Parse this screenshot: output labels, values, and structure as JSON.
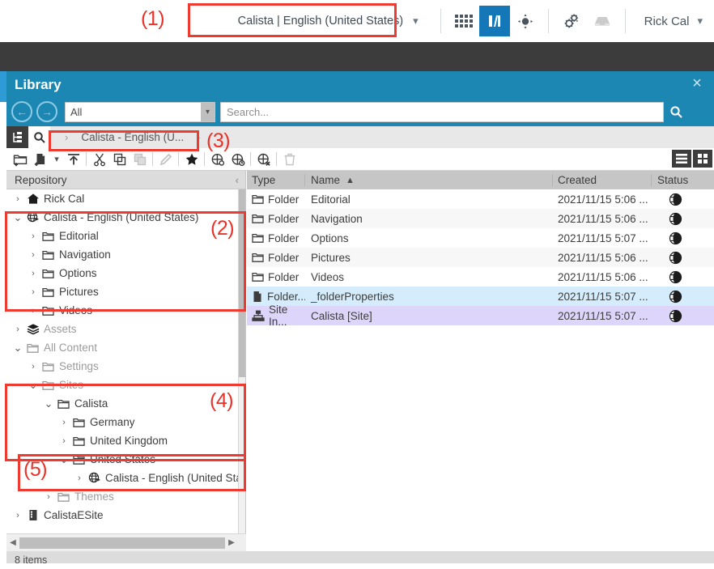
{
  "appbar": {
    "site_selector": {
      "label": "Calista | English (United States)",
      "chevron": "chevron-down-icon"
    },
    "icons": [
      {
        "name": "apps-grid-icon",
        "selected": false
      },
      {
        "name": "library-books-icon",
        "selected": true
      },
      {
        "name": "sites-target-icon",
        "selected": false
      },
      {
        "name": "gears-settings-icon",
        "selected": false
      },
      {
        "name": "inbox-tray-icon",
        "selected": false
      }
    ],
    "user": {
      "name": "Rick Cal",
      "chevron": "chevron-down-icon"
    }
  },
  "annotations": [
    {
      "label": "(1)"
    },
    {
      "label": "(2)"
    },
    {
      "label": "(3)"
    },
    {
      "label": "(4)"
    },
    {
      "label": "(5)"
    }
  ],
  "library": {
    "title": "Library",
    "close_label": "×",
    "nav": {
      "back_icon": "arrow-back-icon",
      "forward_icon": "arrow-forward-icon",
      "scope_value": "All",
      "scope_caret": "⌄",
      "search_placeholder": "Search...",
      "search_value": "",
      "search_icon": "search-icon"
    },
    "breadcrumb": {
      "tree_toggle_icon": "tree-view-icon",
      "search_toggle_icon": "search-icon",
      "lead_sep": "›",
      "crumb": "Calista - English (U...",
      "trail_sep": "›"
    },
    "toolbar": {
      "buttons": [
        {
          "name": "new-folder-button",
          "disabled": false
        },
        {
          "name": "new-content-button",
          "disabled": false
        },
        {
          "name": "new-content-dropdown-chevron",
          "disabled": false
        },
        {
          "name": "upload-button",
          "disabled": false
        },
        {
          "name": "cut-button",
          "disabled": false
        },
        {
          "name": "copy-button",
          "disabled": false
        },
        {
          "name": "paste-button",
          "disabled": true
        },
        {
          "name": "edit-pencil-button",
          "disabled": true
        },
        {
          "name": "favorite-star-button",
          "disabled": false
        },
        {
          "name": "publish-button",
          "disabled": false
        },
        {
          "name": "publish-now-button",
          "disabled": false
        },
        {
          "name": "unpublish-button",
          "disabled": false
        },
        {
          "name": "delete-button",
          "disabled": true
        }
      ],
      "view_list_icon": "list-view-icon",
      "view_grid_icon": "grid-view-icon"
    },
    "tree": {
      "header": "Repository",
      "collapse_icon": "‹",
      "nodes": [
        {
          "label": "Rick Cal",
          "indent": 0,
          "twisty": "›",
          "icon": "home-icon",
          "muted": false
        },
        {
          "label": "Calista - English (United States)",
          "indent": 0,
          "twisty": "⌄",
          "icon": "globe-icon",
          "muted": false
        },
        {
          "label": "Editorial",
          "indent": 1,
          "twisty": "›",
          "icon": "folder-icon",
          "muted": false
        },
        {
          "label": "Navigation",
          "indent": 1,
          "twisty": "›",
          "icon": "folder-icon",
          "muted": false
        },
        {
          "label": "Options",
          "indent": 1,
          "twisty": "›",
          "icon": "folder-icon",
          "muted": false
        },
        {
          "label": "Pictures",
          "indent": 1,
          "twisty": "›",
          "icon": "folder-icon",
          "muted": false
        },
        {
          "label": "Videos",
          "indent": 1,
          "twisty": "›",
          "icon": "folder-icon",
          "muted": false
        },
        {
          "label": "Assets",
          "indent": 0,
          "twisty": "›",
          "icon": "assets-icon",
          "muted": true
        },
        {
          "label": "All Content",
          "indent": 0,
          "twisty": "⌄",
          "icon": "folder-icon",
          "muted": true
        },
        {
          "label": "Settings",
          "indent": 1,
          "twisty": "›",
          "icon": "folder-icon",
          "muted": true
        },
        {
          "label": "Sites",
          "indent": 1,
          "twisty": "⌄",
          "icon": "folder-icon",
          "muted": true
        },
        {
          "label": "Calista",
          "indent": 2,
          "twisty": "⌄",
          "icon": "folder-icon",
          "muted": false
        },
        {
          "label": "Germany",
          "indent": 3,
          "twisty": "›",
          "icon": "folder-icon",
          "muted": false
        },
        {
          "label": "United Kingdom",
          "indent": 3,
          "twisty": "›",
          "icon": "folder-icon",
          "muted": false
        },
        {
          "label": "United States",
          "indent": 3,
          "twisty": "⌄",
          "icon": "folder-icon",
          "muted": false
        },
        {
          "label": "Calista - English (United States)",
          "indent": 4,
          "twisty": "›",
          "icon": "globe-icon",
          "muted": false
        },
        {
          "label": "Themes",
          "indent": 2,
          "twisty": "›",
          "icon": "folder-icon",
          "muted": true
        },
        {
          "label": "CalistaESite",
          "indent": 0,
          "twisty": "›",
          "icon": "esite-icon",
          "muted": false
        }
      ]
    },
    "list": {
      "columns": [
        "Type",
        "Name",
        "Created",
        "Status"
      ],
      "sort_column": "Name",
      "sort_indicator": "▲",
      "rows": [
        {
          "type": "Folder",
          "type_icon": "folder-icon",
          "name": "Editorial",
          "created": "2021/11/15 5:06 ...",
          "status_icon": "publish-globe-icon",
          "highlight": "none"
        },
        {
          "type": "Folder",
          "type_icon": "folder-icon",
          "name": "Navigation",
          "created": "2021/11/15 5:06 ...",
          "status_icon": "publish-globe-icon",
          "highlight": "alt"
        },
        {
          "type": "Folder",
          "type_icon": "folder-icon",
          "name": "Options",
          "created": "2021/11/15 5:07 ...",
          "status_icon": "publish-globe-icon",
          "highlight": "none"
        },
        {
          "type": "Folder",
          "type_icon": "folder-icon",
          "name": "Pictures",
          "created": "2021/11/15 5:06 ...",
          "status_icon": "publish-globe-icon",
          "highlight": "alt"
        },
        {
          "type": "Folder",
          "type_icon": "folder-icon",
          "name": "Videos",
          "created": "2021/11/15 5:06 ...",
          "status_icon": "publish-globe-icon",
          "highlight": "none"
        },
        {
          "type": "Folder...",
          "type_icon": "document-icon",
          "name": "_folderProperties",
          "created": "2021/11/15 5:07 ...",
          "status_icon": "publish-globe-icon",
          "highlight": "blue"
        },
        {
          "type": "Site In...",
          "type_icon": "sitemap-icon",
          "name": "Calista [Site]",
          "created": "2021/11/15 5:07 ...",
          "status_icon": "publish-globe-icon",
          "highlight": "purple"
        }
      ]
    },
    "status_bar": {
      "text": "8 items"
    }
  }
}
